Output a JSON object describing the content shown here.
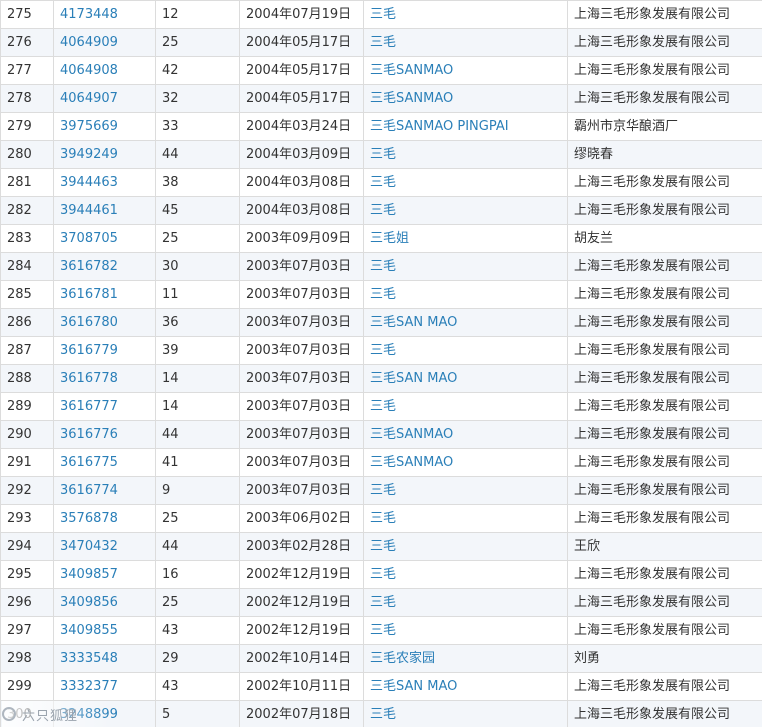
{
  "rows": [
    {
      "no": "275",
      "reg": "4173448",
      "cls": "12",
      "date": "2004年07月19日",
      "mark": "三毛",
      "owner": "上海三毛形象发展有限公司"
    },
    {
      "no": "276",
      "reg": "4064909",
      "cls": "25",
      "date": "2004年05月17日",
      "mark": "三毛",
      "owner": "上海三毛形象发展有限公司"
    },
    {
      "no": "277",
      "reg": "4064908",
      "cls": "42",
      "date": "2004年05月17日",
      "mark": "三毛SANMAO",
      "owner": "上海三毛形象发展有限公司"
    },
    {
      "no": "278",
      "reg": "4064907",
      "cls": "32",
      "date": "2004年05月17日",
      "mark": "三毛SANMAO",
      "owner": "上海三毛形象发展有限公司"
    },
    {
      "no": "279",
      "reg": "3975669",
      "cls": "33",
      "date": "2004年03月24日",
      "mark": "三毛SANMAO PINGPAI",
      "owner": "霸州市京华酿酒厂"
    },
    {
      "no": "280",
      "reg": "3949249",
      "cls": "44",
      "date": "2004年03月09日",
      "mark": "三毛",
      "owner": "缪晓春"
    },
    {
      "no": "281",
      "reg": "3944463",
      "cls": "38",
      "date": "2004年03月08日",
      "mark": "三毛",
      "owner": "上海三毛形象发展有限公司"
    },
    {
      "no": "282",
      "reg": "3944461",
      "cls": "45",
      "date": "2004年03月08日",
      "mark": "三毛",
      "owner": "上海三毛形象发展有限公司"
    },
    {
      "no": "283",
      "reg": "3708705",
      "cls": "25",
      "date": "2003年09月09日",
      "mark": "三毛姐",
      "owner": "胡友兰"
    },
    {
      "no": "284",
      "reg": "3616782",
      "cls": "30",
      "date": "2003年07月03日",
      "mark": "三毛",
      "owner": "上海三毛形象发展有限公司"
    },
    {
      "no": "285",
      "reg": "3616781",
      "cls": "11",
      "date": "2003年07月03日",
      "mark": "三毛",
      "owner": "上海三毛形象发展有限公司"
    },
    {
      "no": "286",
      "reg": "3616780",
      "cls": "36",
      "date": "2003年07月03日",
      "mark": "三毛SAN MAO",
      "owner": "上海三毛形象发展有限公司"
    },
    {
      "no": "287",
      "reg": "3616779",
      "cls": "39",
      "date": "2003年07月03日",
      "mark": "三毛",
      "owner": "上海三毛形象发展有限公司"
    },
    {
      "no": "288",
      "reg": "3616778",
      "cls": "14",
      "date": "2003年07月03日",
      "mark": "三毛SAN MAO",
      "owner": "上海三毛形象发展有限公司"
    },
    {
      "no": "289",
      "reg": "3616777",
      "cls": "14",
      "date": "2003年07月03日",
      "mark": "三毛",
      "owner": "上海三毛形象发展有限公司"
    },
    {
      "no": "290",
      "reg": "3616776",
      "cls": "44",
      "date": "2003年07月03日",
      "mark": "三毛SANMAO",
      "owner": "上海三毛形象发展有限公司"
    },
    {
      "no": "291",
      "reg": "3616775",
      "cls": "41",
      "date": "2003年07月03日",
      "mark": "三毛SANMAO",
      "owner": "上海三毛形象发展有限公司"
    },
    {
      "no": "292",
      "reg": "3616774",
      "cls": "9",
      "date": "2003年07月03日",
      "mark": "三毛",
      "owner": "上海三毛形象发展有限公司"
    },
    {
      "no": "293",
      "reg": "3576878",
      "cls": "25",
      "date": "2003年06月02日",
      "mark": "三毛",
      "owner": "上海三毛形象发展有限公司"
    },
    {
      "no": "294",
      "reg": "3470432",
      "cls": "44",
      "date": "2003年02月28日",
      "mark": "三毛",
      "owner": "王欣"
    },
    {
      "no": "295",
      "reg": "3409857",
      "cls": "16",
      "date": "2002年12月19日",
      "mark": "三毛",
      "owner": "上海三毛形象发展有限公司"
    },
    {
      "no": "296",
      "reg": "3409856",
      "cls": "25",
      "date": "2002年12月19日",
      "mark": "三毛",
      "owner": "上海三毛形象发展有限公司"
    },
    {
      "no": "297",
      "reg": "3409855",
      "cls": "43",
      "date": "2002年12月19日",
      "mark": "三毛",
      "owner": "上海三毛形象发展有限公司"
    },
    {
      "no": "298",
      "reg": "3333548",
      "cls": "29",
      "date": "2002年10月14日",
      "mark": "三毛农家园",
      "owner": "刘勇"
    },
    {
      "no": "299",
      "reg": "3332377",
      "cls": "43",
      "date": "2002年10月11日",
      "mark": "三毛SAN MAO",
      "owner": "上海三毛形象发展有限公司"
    },
    {
      "no": "300",
      "reg": "3248899",
      "cls": "5",
      "date": "2002年07月18日",
      "mark": "三毛",
      "owner": "上海三毛形象发展有限公司"
    }
  ],
  "watermark": {
    "text": "六只狐狸"
  },
  "colors": {
    "link": "#2a7fb8",
    "text": "#333333",
    "row_alt": "#f3f6fa",
    "border": "#dcdcdc"
  }
}
